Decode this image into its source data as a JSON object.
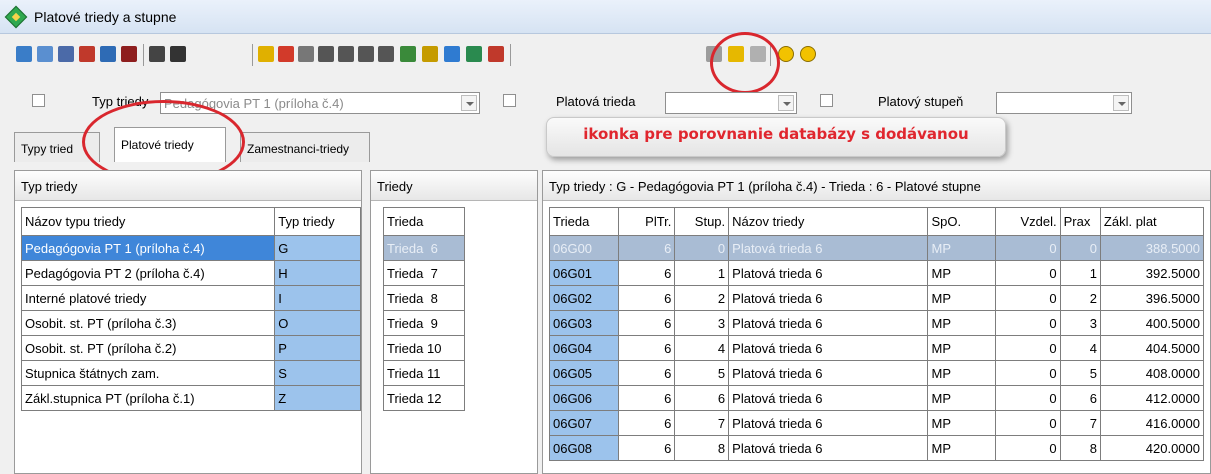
{
  "window": {
    "title": "Platové triedy a stupne"
  },
  "filters": {
    "typ_label": "Typ triedy",
    "typ_value": "Pedagógovia PT 1 (príloha č.4)",
    "platova_label": "Platová trieda",
    "platova_value": "",
    "stupen_label": "Platový stupeň",
    "stupen_value": ""
  },
  "tabs": [
    {
      "label": "Typy tried"
    },
    {
      "label": "Platové triedy"
    },
    {
      "label": "Zamestnanci-triedy"
    }
  ],
  "callout": "ikonka pre porovnanie databázy s dodávanou",
  "panel_types": {
    "header": "Typ triedy",
    "columns": [
      "Názov typu triedy",
      "Typ triedy"
    ],
    "rows": [
      [
        "Pedagógovia PT 1 (príloha č.4)",
        "G"
      ],
      [
        "Pedagógovia PT 2 (príloha č.4)",
        "H"
      ],
      [
        "Interné platové triedy",
        "I"
      ],
      [
        "Osobit. st. PT (príloha č.3)",
        "O"
      ],
      [
        "Osobit. st. PT (príloha č.2)",
        "P"
      ],
      [
        "Stupnica štátnych zam.",
        "S"
      ],
      [
        "Zákl.stupnica PT (príloha č.1)",
        "Z"
      ]
    ]
  },
  "panel_classes": {
    "header": "Triedy",
    "column": "Trieda",
    "rows": [
      "Trieda  6",
      "Trieda  7",
      "Trieda  8",
      "Trieda  9",
      "Trieda 10",
      "Trieda 11",
      "Trieda 12"
    ]
  },
  "panel_grades": {
    "header": "Typ triedy : G - Pedagógovia PT 1 (príloha č.4) - Trieda : 6 - Platové stupne",
    "columns": [
      "Trieda",
      "PlTr.",
      "Stup.",
      "Názov triedy",
      "SpO.",
      "Vzdel.",
      "Prax",
      "Zákl. plat"
    ],
    "rows": [
      [
        "06G00",
        "6",
        "0",
        "Platová trieda 6",
        "MP",
        "0",
        "0",
        "388.5000"
      ],
      [
        "06G01",
        "6",
        "1",
        "Platová trieda 6",
        "MP",
        "0",
        "1",
        "392.5000"
      ],
      [
        "06G02",
        "6",
        "2",
        "Platová trieda 6",
        "MP",
        "0",
        "2",
        "396.5000"
      ],
      [
        "06G03",
        "6",
        "3",
        "Platová trieda 6",
        "MP",
        "0",
        "3",
        "400.5000"
      ],
      [
        "06G04",
        "6",
        "4",
        "Platová trieda 6",
        "MP",
        "0",
        "4",
        "404.5000"
      ],
      [
        "06G05",
        "6",
        "5",
        "Platová trieda 6",
        "MP",
        "0",
        "5",
        "408.0000"
      ],
      [
        "06G06",
        "6",
        "6",
        "Platová trieda 6",
        "MP",
        "0",
        "6",
        "412.0000"
      ],
      [
        "06G07",
        "6",
        "7",
        "Platová trieda 6",
        "MP",
        "0",
        "7",
        "416.0000"
      ],
      [
        "06G08",
        "6",
        "8",
        "Platová trieda 6",
        "MP",
        "0",
        "8",
        "420.0000"
      ]
    ]
  },
  "toolbar_icons": [
    {
      "name": "first-record-icon",
      "color": "#3a7dc8"
    },
    {
      "name": "grid-icon",
      "color": "#5a8fd0"
    },
    {
      "name": "table-icon",
      "color": "#4b6aa8"
    },
    {
      "name": "edit-icon",
      "color": "#c0392b"
    },
    {
      "name": "copy-icon",
      "color": "#2e6bb5"
    },
    {
      "name": "delete-icon",
      "color": "#8e1e1e"
    },
    {
      "name": "print-icon",
      "color": "#444444"
    },
    {
      "name": "preview-icon",
      "color": "#333333"
    },
    {
      "name": "filter-icon",
      "color": "#e0b000"
    },
    {
      "name": "clear-filter-icon",
      "color": "#d23a2a"
    },
    {
      "name": "sort-icon",
      "color": "#777777"
    },
    {
      "name": "first-icon",
      "color": "#555555"
    },
    {
      "name": "prev-icon",
      "color": "#555555"
    },
    {
      "name": "next-icon",
      "color": "#555555"
    },
    {
      "name": "last-icon",
      "color": "#555555"
    },
    {
      "name": "search-icon",
      "color": "#3a8a3a"
    },
    {
      "name": "calculator-icon",
      "color": "#c59b00"
    },
    {
      "name": "export-icon",
      "color": "#2f7bd1"
    },
    {
      "name": "import-icon",
      "color": "#2a8a4f"
    },
    {
      "name": "transfer-icon",
      "color": "#c0392b"
    },
    {
      "name": "refresh-icon",
      "color": "#9c9c9c"
    },
    {
      "name": "compare-database-icon",
      "color": "#e6b800"
    },
    {
      "name": "disabled-icon",
      "color": "#b0b0b0"
    },
    {
      "name": "option-1-icon",
      "color": "#f2c200"
    },
    {
      "name": "option-2-icon",
      "color": "#f2c200"
    }
  ]
}
